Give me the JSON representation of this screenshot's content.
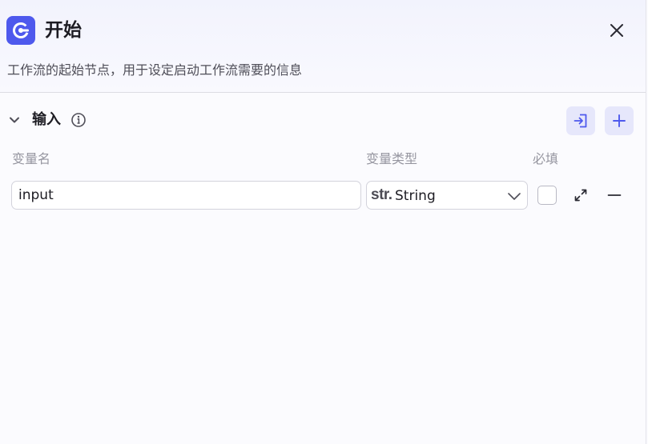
{
  "node": {
    "title": "开始",
    "description": "工作流的起始节点，用于设定启动工作流需要的信息",
    "icon": "start-node-icon",
    "accent_color": "#4e59ed"
  },
  "header": {
    "close_icon": "close-icon"
  },
  "inputs_section": {
    "title": "输入",
    "info_icon": "info-icon",
    "collapse_icon": "chevron-down-icon",
    "import_icon": "import-icon",
    "add_icon": "plus-icon",
    "columns": {
      "name": "变量名",
      "type": "变量类型",
      "required": "必填"
    },
    "rows": [
      {
        "name": "input",
        "type_prefix": "str.",
        "type": "String",
        "required": false
      }
    ]
  }
}
